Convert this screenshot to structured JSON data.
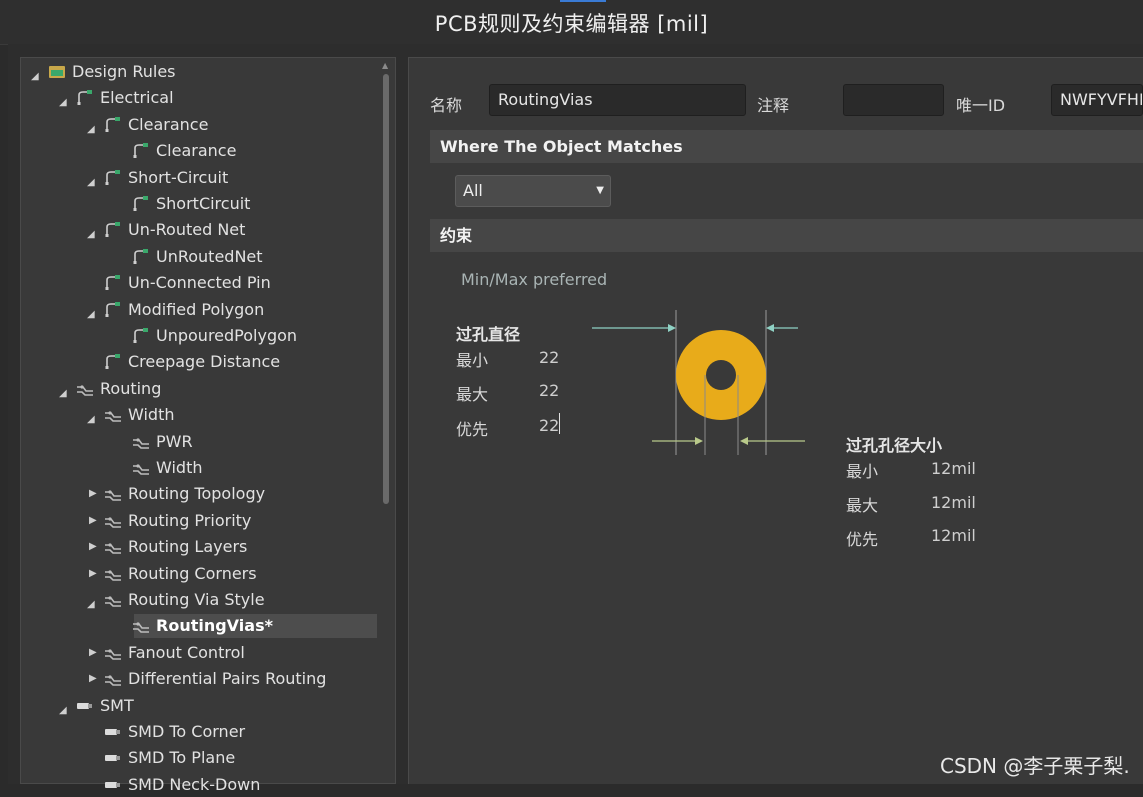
{
  "window": {
    "title": "PCB规则及约束编辑器 [mil]"
  },
  "tree": {
    "items": [
      {
        "label": "Design Rules",
        "icon": "design-rules-icon"
      },
      {
        "label": "Electrical",
        "icon": "electrical-rule-icon"
      },
      {
        "label": "Clearance",
        "icon": "electrical-rule-icon"
      },
      {
        "label": "Clearance",
        "icon": "electrical-rule-icon"
      },
      {
        "label": "Short-Circuit",
        "icon": "electrical-rule-icon"
      },
      {
        "label": "ShortCircuit",
        "icon": "electrical-rule-icon"
      },
      {
        "label": "Un-Routed Net",
        "icon": "electrical-rule-icon"
      },
      {
        "label": "UnRoutedNet",
        "icon": "electrical-rule-icon"
      },
      {
        "label": "Un-Connected Pin",
        "icon": "electrical-rule-icon"
      },
      {
        "label": "Modified Polygon",
        "icon": "electrical-rule-icon"
      },
      {
        "label": "UnpouredPolygon",
        "icon": "electrical-rule-icon"
      },
      {
        "label": "Creepage Distance",
        "icon": "electrical-rule-icon"
      },
      {
        "label": "Routing",
        "icon": "routing-rule-icon"
      },
      {
        "label": "Width",
        "icon": "routing-rule-icon"
      },
      {
        "label": "PWR",
        "icon": "routing-rule-icon"
      },
      {
        "label": "Width",
        "icon": "routing-rule-icon"
      },
      {
        "label": "Routing Topology",
        "icon": "routing-rule-icon"
      },
      {
        "label": "Routing Priority",
        "icon": "routing-rule-icon"
      },
      {
        "label": "Routing Layers",
        "icon": "routing-rule-icon"
      },
      {
        "label": "Routing Corners",
        "icon": "routing-rule-icon"
      },
      {
        "label": "Routing Via Style",
        "icon": "routing-rule-icon"
      },
      {
        "label": "RoutingVias*",
        "icon": "routing-rule-icon"
      },
      {
        "label": "Fanout Control",
        "icon": "routing-rule-icon"
      },
      {
        "label": "Differential Pairs Routing",
        "icon": "routing-rule-icon"
      },
      {
        "label": "SMT",
        "icon": "smt-rule-icon"
      },
      {
        "label": "SMD To Corner",
        "icon": "smt-rule-icon"
      },
      {
        "label": "SMD To Plane",
        "icon": "smt-rule-icon"
      },
      {
        "label": "SMD Neck-Down",
        "icon": "smt-rule-icon"
      }
    ]
  },
  "rule": {
    "name_label": "名称",
    "name_value": "RoutingVias",
    "comment_label": "注释",
    "comment_value": "",
    "id_label": "唯一ID",
    "id_value": "NWFYVFHE"
  },
  "where": {
    "header": "Where The Object Matches",
    "scope_value": "All"
  },
  "constraints": {
    "header": "约束",
    "preference": "Min/Max preferred",
    "via_diameter": {
      "title": "过孔直径",
      "min_label": "最小",
      "min_value": "22",
      "max_label": "最大",
      "max_value": "22",
      "pref_label": "优先",
      "pref_value": "22"
    },
    "hole_size": {
      "title": "过孔孔径大小",
      "min_label": "最小",
      "min_value": "12mil",
      "max_label": "最大",
      "max_value": "12mil",
      "pref_label": "优先",
      "pref_value": "12mil"
    },
    "colors": {
      "via_ring": "#e8ab1a",
      "hole": "#393939",
      "arrow": "#8fd1c4",
      "arrow_hole": "#b9c98a"
    }
  },
  "watermark": "CSDN @李子栗子梨."
}
